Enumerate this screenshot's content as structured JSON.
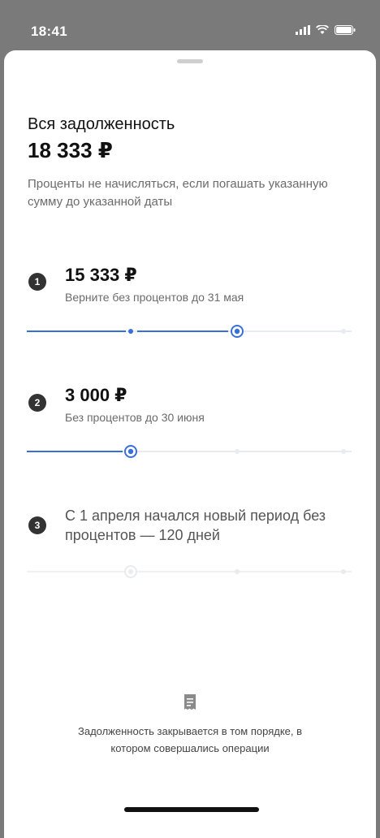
{
  "status_bar": {
    "time": "18:41"
  },
  "summary": {
    "title": "Вся задолженность",
    "amount": "18 333 ₽",
    "info": "Проценты не начисляться, если погашать указанную сумму до указанной даты"
  },
  "steps": [
    {
      "number": "1",
      "amount": "15 333 ₽",
      "subtitle": "Верните без процентов до 31 мая",
      "progress": "current-at-stage-2-of-3"
    },
    {
      "number": "2",
      "amount": "3 000 ₽",
      "subtitle": "Без процентов до 30 июня",
      "progress": "current-at-stage-1-of-3"
    },
    {
      "number": "3",
      "text": "С 1 апреля начался новый период без процентов — 120 дней",
      "progress": "starting"
    }
  ],
  "footer": {
    "icon": "receipt-icon",
    "text": "Задолженность закрывается в том порядке, в котором совершались операции"
  },
  "colors": {
    "accent": "#3a6fd8",
    "track": "#e8ebf0",
    "badge": "#333333"
  }
}
